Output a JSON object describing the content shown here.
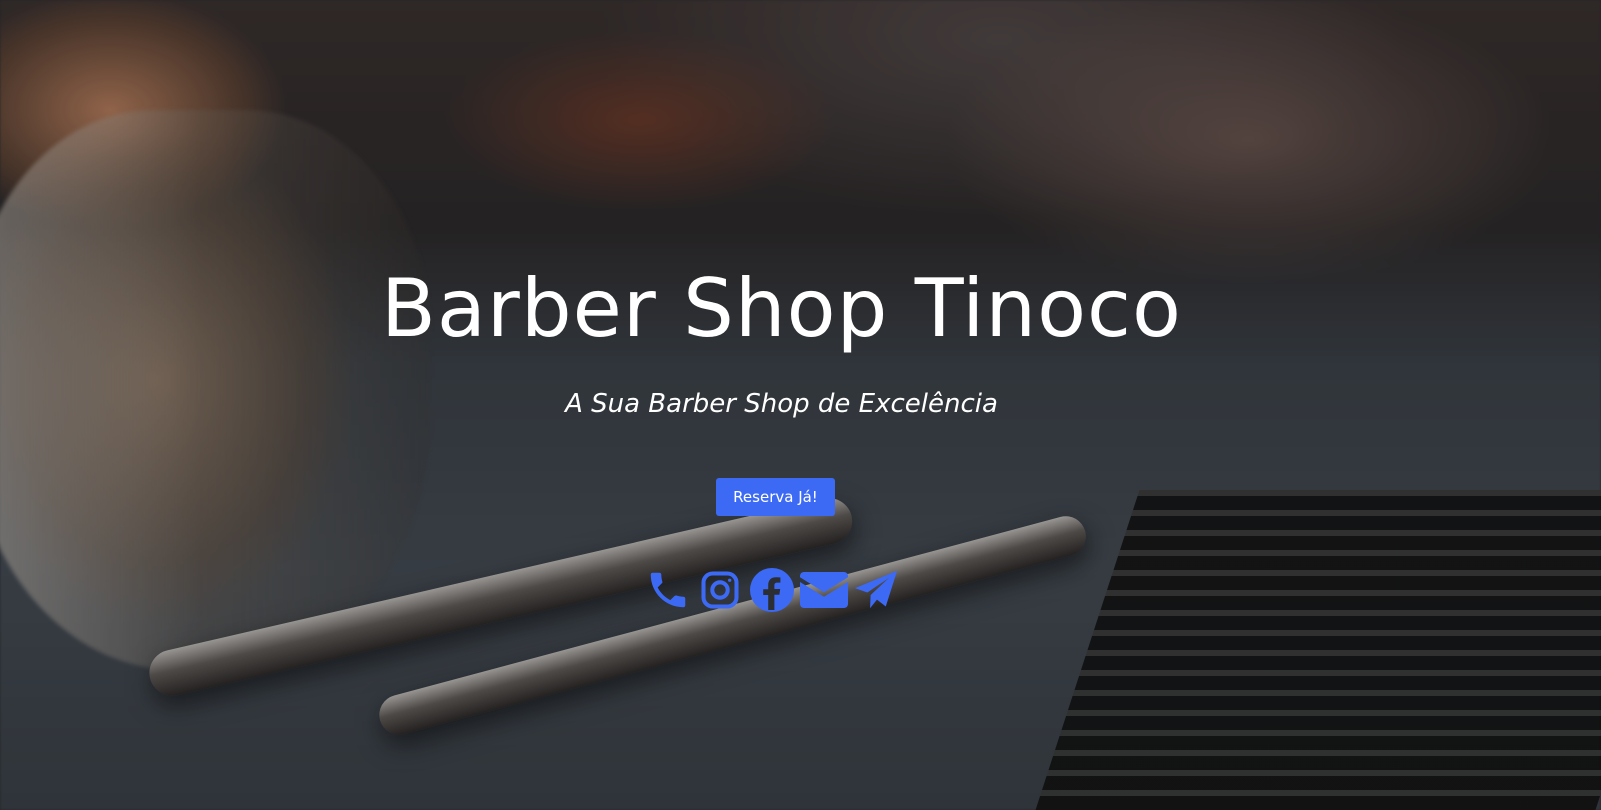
{
  "hero": {
    "title": "Barber Shop Tinoco",
    "subtitle": "A Sua Barber Shop de Excelência",
    "cta_label": "Reserva Já!"
  },
  "social": {
    "icons": [
      "phone-icon",
      "instagram-icon",
      "facebook-icon",
      "email-icon",
      "telegram-icon"
    ]
  },
  "colors": {
    "accent": "#3d6af5",
    "text": "#ffffff"
  }
}
